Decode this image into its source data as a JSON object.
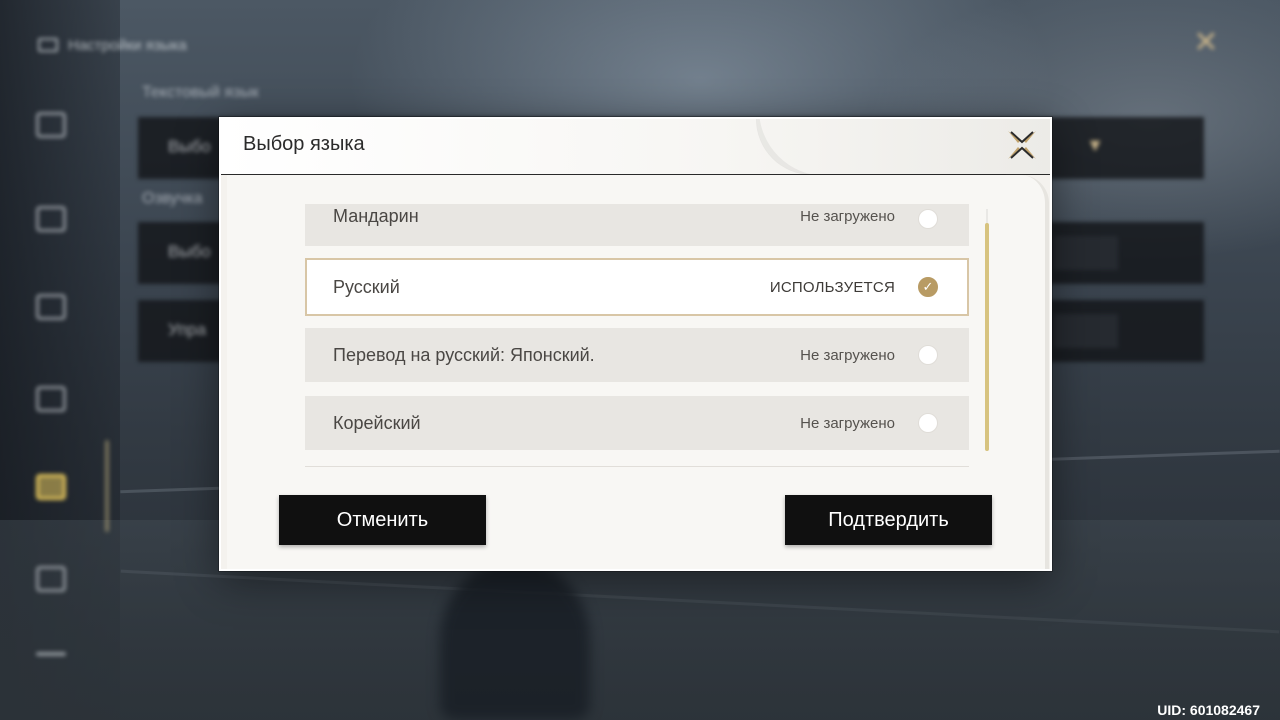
{
  "background": {
    "header_title": "Настройки языка",
    "section_text_language": "Текстовый язык",
    "section_voice_language": "Озвучка",
    "row_labels": [
      "Выбо",
      "Выбо",
      "Упра"
    ]
  },
  "modal": {
    "title": "Выбор языка",
    "languages": [
      {
        "name": "Мандарин",
        "status": "Не загружено",
        "selected": false
      },
      {
        "name": "Русский",
        "status": "ИСПОЛЬЗУЕТСЯ",
        "selected": true
      },
      {
        "name": "Перевод на русский: Японский.",
        "status": "Не загружено",
        "selected": false
      },
      {
        "name": "Корейский",
        "status": "Не загружено",
        "selected": false
      }
    ],
    "cancel_label": "Отменить",
    "confirm_label": "Подтвердить",
    "check_glyph": "✓"
  },
  "footer": {
    "uid": "UID: 601082467"
  },
  "colors": {
    "accent_gold": "#b89b64",
    "scroll_thumb": "#d7c37f",
    "button_bg": "#101010",
    "active_sidebar": "#e2c45c"
  },
  "icons": {
    "close": "close-x-icon",
    "check": "check-icon"
  }
}
